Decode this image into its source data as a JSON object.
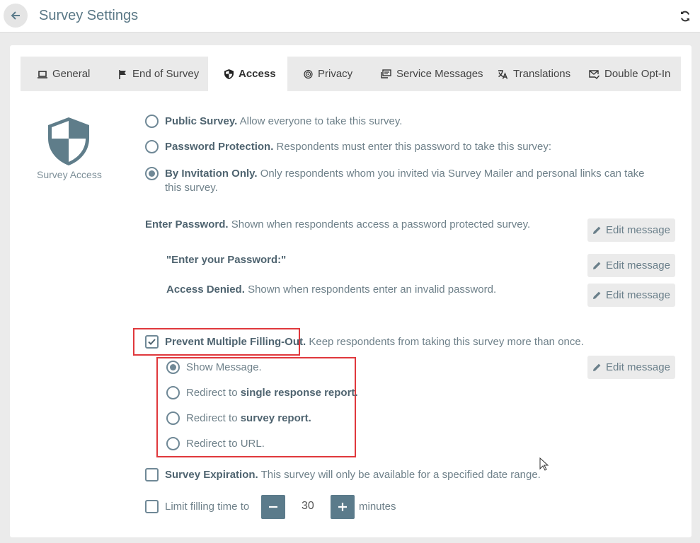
{
  "header": {
    "title": "Survey Settings"
  },
  "tabs": [
    {
      "label": "General",
      "icon": "laptop-icon"
    },
    {
      "label": "End of Survey",
      "icon": "flag-icon"
    },
    {
      "label": "Access",
      "icon": "shield-icon"
    },
    {
      "label": "Privacy",
      "icon": "fingerprint-icon"
    },
    {
      "label": "Service Messages",
      "icon": "message-icon"
    },
    {
      "label": "Translations",
      "icon": "translate-icon"
    },
    {
      "label": "Double Opt-In",
      "icon": "mail-check-icon"
    }
  ],
  "section": {
    "label": "Survey Access"
  },
  "access_options": {
    "public": {
      "title": "Public Survey.",
      "desc": "Allow everyone to take this survey."
    },
    "password": {
      "title": "Password Protection.",
      "desc": "Respondents must enter this password to take this survey:"
    },
    "invitation": {
      "title": "By Invitation Only.",
      "desc": "Only respondents whom you invited via Survey Mailer and personal links can take this survey."
    },
    "selected": "invitation"
  },
  "messages": {
    "enter_password": {
      "title": "Enter Password.",
      "desc": "Shown when respondents access a password protected survey."
    },
    "password_prompt": "\"Enter your Password:\"",
    "access_denied": {
      "title": "Access Denied.",
      "desc": "Shown when respondents enter an invalid password."
    },
    "edit_label": "Edit message"
  },
  "prevent_multiple": {
    "title": "Prevent Multiple Filling-Out.",
    "desc": "Keep respondents from taking this survey more than once.",
    "checked": true,
    "options": {
      "show_message": "Show Message.",
      "redirect_prefix": "Redirect to",
      "single_report": "single response report.",
      "survey_report": "survey report.",
      "url": "Redirect to URL."
    },
    "selected": "show_message"
  },
  "expiration": {
    "title": "Survey Expiration.",
    "desc": "This survey will only be available for a specified date range.",
    "checked": false
  },
  "time_limit": {
    "label": "Limit filling time to",
    "value": "30",
    "unit": "minutes",
    "checked": false
  }
}
